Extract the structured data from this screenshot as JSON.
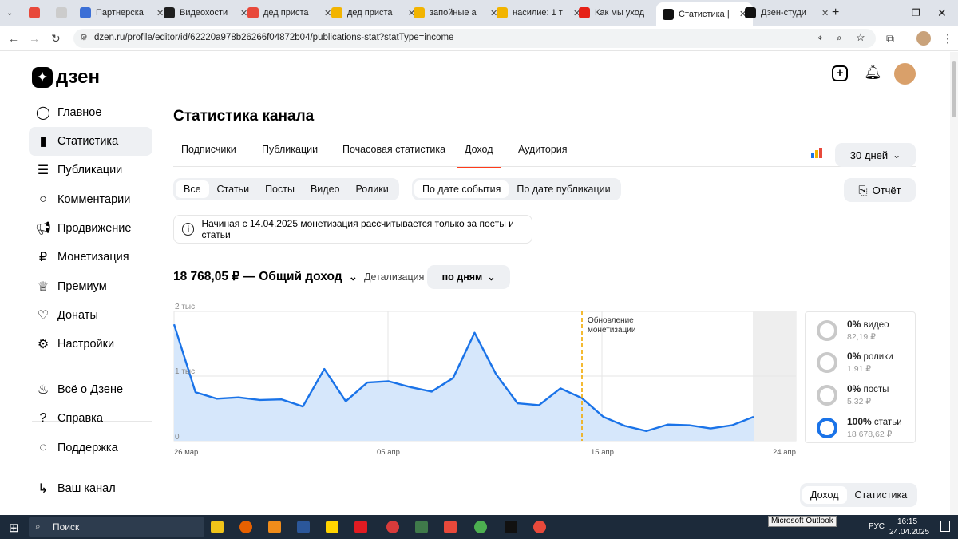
{
  "browser": {
    "tabs": [
      {
        "title": "Партнерска",
        "color": "#3b6fd6"
      },
      {
        "title": "Видеохости",
        "color": "#1f1f1f"
      },
      {
        "title": "дед приста",
        "color": "#e8493b"
      },
      {
        "title": "дед приста",
        "color": "#f2b400"
      },
      {
        "title": "запойные а",
        "color": "#f2b400"
      },
      {
        "title": "насилие: 1 т",
        "color": "#f2b400"
      },
      {
        "title": "Как мы уход",
        "color": "#e62117"
      },
      {
        "title": "Статистика |",
        "color": "#111111"
      },
      {
        "title": "Дзен-студи",
        "color": "#111111"
      }
    ],
    "url": "dzen.ru/profile/editor/id/62220a978b26266f04872b04/publications-stat?statType=income"
  },
  "logo": "дзен",
  "sidebar": {
    "items": [
      {
        "label": "Главное",
        "icon": "planet-icon"
      },
      {
        "label": "Статистика",
        "icon": "bar-chart-icon"
      },
      {
        "label": "Публикации",
        "icon": "publications-icon"
      },
      {
        "label": "Комментарии",
        "icon": "comment-icon"
      },
      {
        "label": "Продвижение",
        "icon": "megaphone-icon"
      },
      {
        "label": "Монетизация",
        "icon": "ruble-icon"
      },
      {
        "label": "Премиум",
        "icon": "crown-icon"
      },
      {
        "label": "Донаты",
        "icon": "donate-icon"
      },
      {
        "label": "Настройки",
        "icon": "gear-icon"
      }
    ],
    "bottom": [
      {
        "label": "Всё о Дзене",
        "icon": "flame-icon"
      },
      {
        "label": "Справка",
        "icon": "help-icon"
      },
      {
        "label": "Поддержка",
        "icon": "chat-icon"
      },
      {
        "label": "Ваш канал",
        "icon": "channel-icon"
      }
    ]
  },
  "page": {
    "title": "Статистика канала",
    "tabs": [
      "Подписчики",
      "Публикации",
      "Почасовая статистика",
      "Доход",
      "Аудитория"
    ],
    "period": "30 дней",
    "type_filters": [
      "Все",
      "Статьи",
      "Посты",
      "Видео",
      "Ролики"
    ],
    "date_filters": [
      "По дате события",
      "По дате публикации"
    ],
    "report_button": "Отчёт",
    "notice": "Начиная с 14.04.2025 монетизация рассчитывается только за посты и статьи",
    "total": "18 768,05 ₽ — Общий доход",
    "detail_label": "Детализация",
    "detail_value": "по дням",
    "bottom_toggle": [
      "Доход",
      "Статистика"
    ]
  },
  "legend": [
    {
      "percent": "0%",
      "label": "видео",
      "amount": "82,19 ₽",
      "fill": 0.0
    },
    {
      "percent": "0%",
      "label": "ролики",
      "amount": "1,91 ₽",
      "fill": 0.0
    },
    {
      "percent": "0%",
      "label": "посты",
      "amount": "5,32 ₽",
      "fill": 0.0
    },
    {
      "percent": "100%",
      "label": "статьи",
      "amount": "18 678,62 ₽",
      "fill": 1.0
    }
  ],
  "chart_data": {
    "type": "area",
    "x_ticks": [
      "26 мар",
      "05 апр",
      "15 апр",
      "24 апр"
    ],
    "y_ticks": [
      "0",
      "1 тыс",
      "2 тыс"
    ],
    "ylim": [
      0,
      2000
    ],
    "annotation": "Обновление монетизации",
    "annotation_x_day": 19.2,
    "days": 30,
    "values": [
      1800,
      750,
      650,
      670,
      630,
      640,
      530,
      1110,
      610,
      900,
      920,
      830,
      760,
      970,
      1670,
      1030,
      580,
      550,
      810,
      660,
      370,
      230,
      150,
      250,
      240,
      190,
      240,
      370
    ],
    "color": "#1a73e8"
  },
  "taskbar": {
    "search": "Поиск",
    "lang": "РУС",
    "time": "16:15",
    "date": "24.04.2025",
    "tooltip": "Microsoft Outlook"
  }
}
